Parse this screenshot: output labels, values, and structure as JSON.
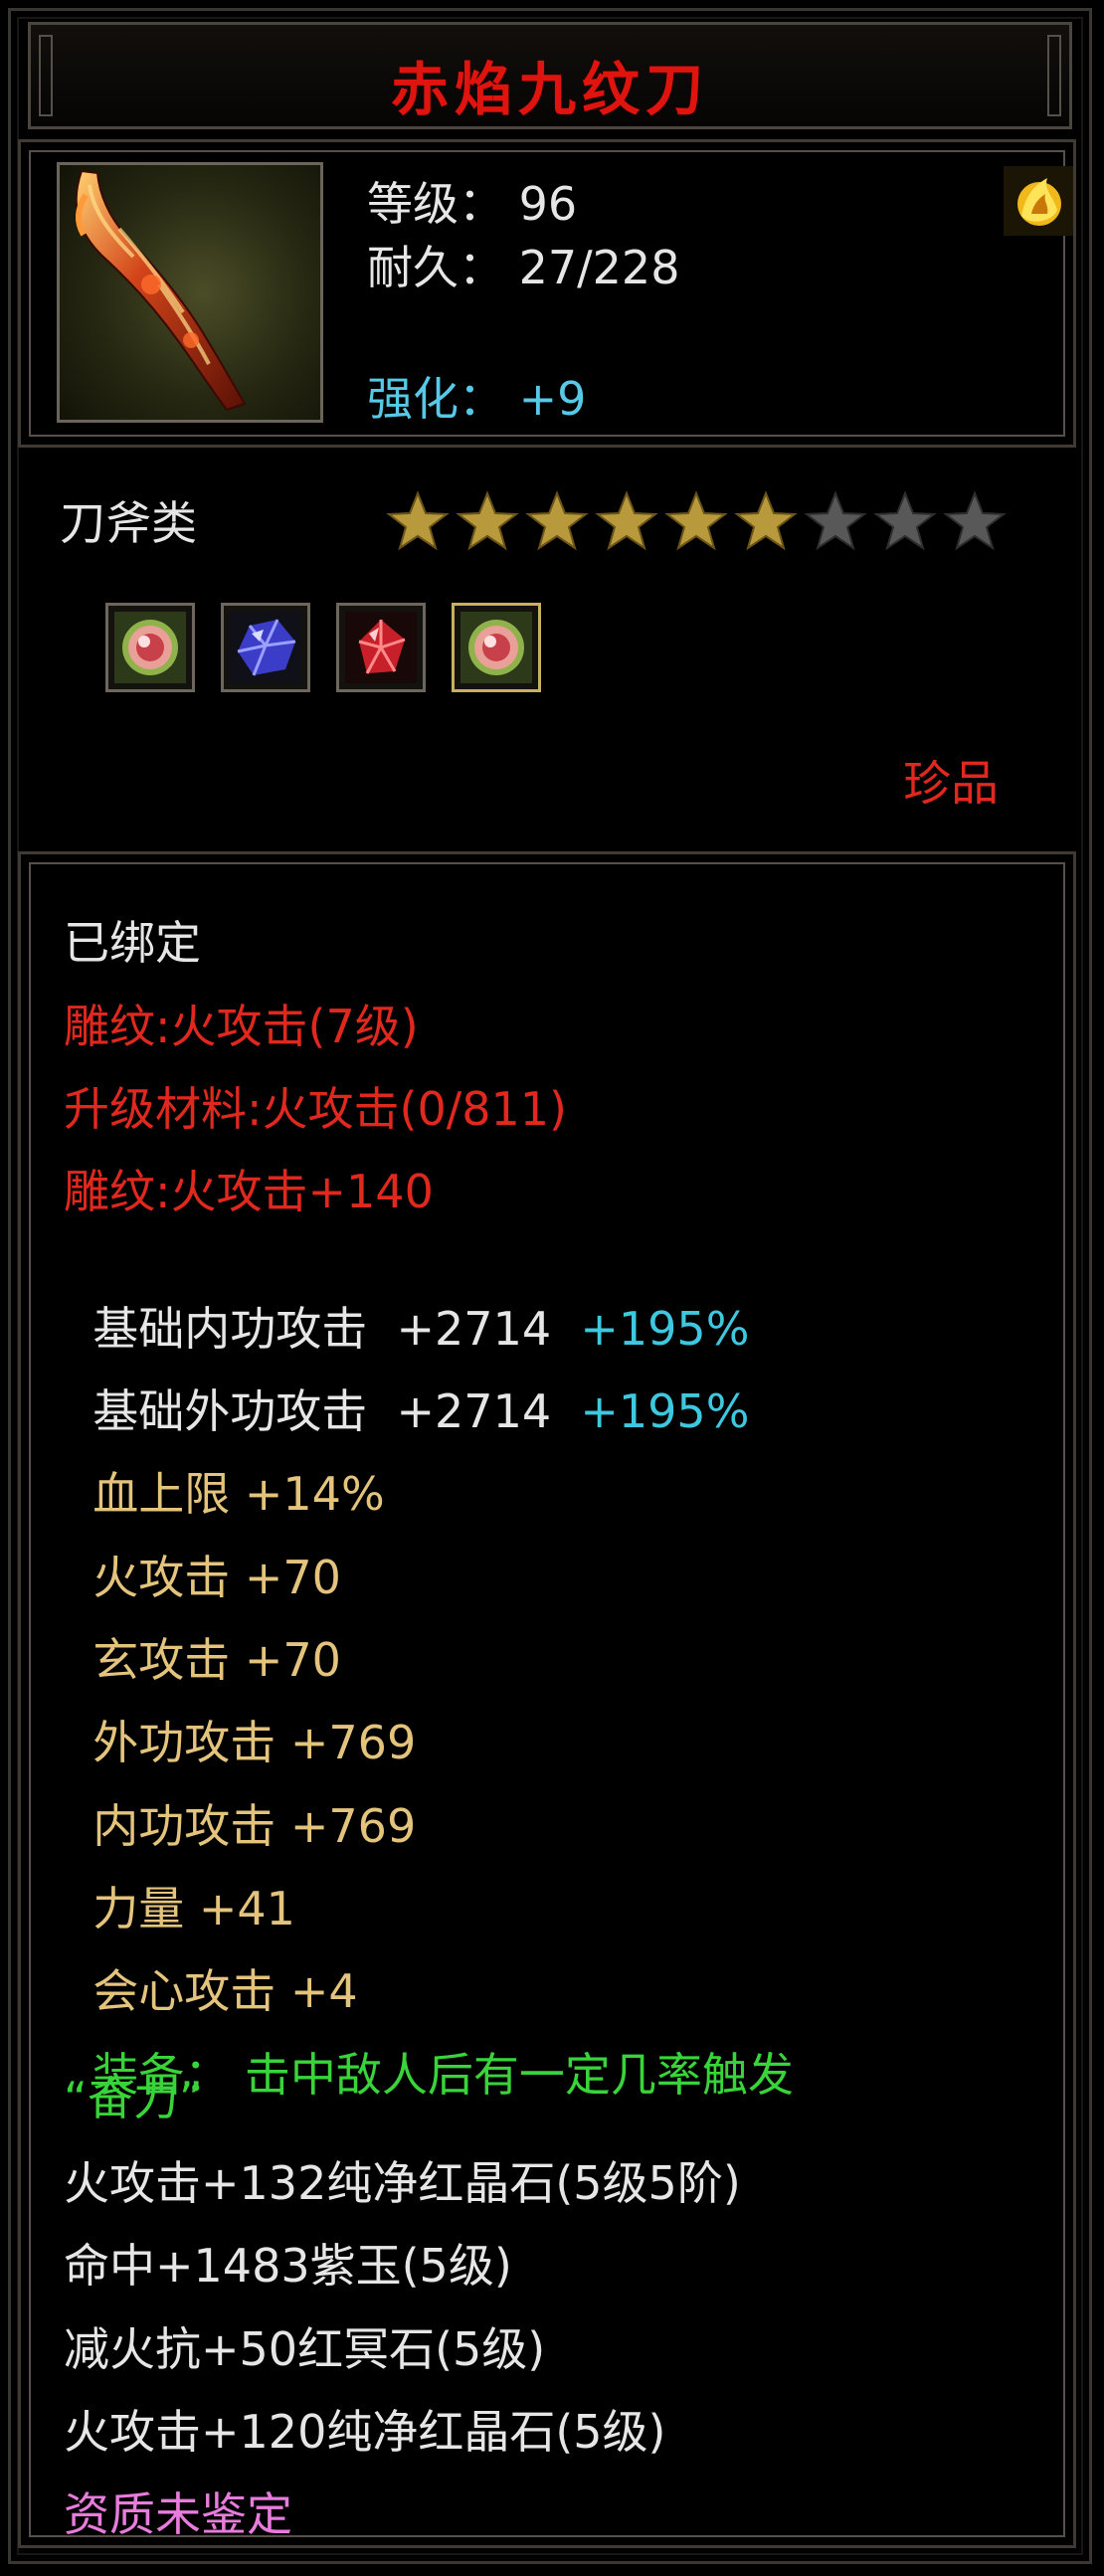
{
  "item": {
    "name": "赤焰九纹刀",
    "level_label": "等级：",
    "level_value": "96",
    "durability_label": "耐久：",
    "durability_value": "27/228",
    "enhance_label": "强化：",
    "enhance_value": "+9",
    "weapon_class": "刀斧类",
    "stars_total": 9,
    "stars_filled": 6,
    "rarity": "珍品",
    "icon": "blade-icon",
    "colors": {
      "title": "#e0140e",
      "rarity": "#e0281e",
      "enhance": "#57c9e6",
      "star_filled": "#b8993c",
      "star_empty": "#585858"
    }
  },
  "gems": [
    {
      "icon": "round-red-gem-icon",
      "selected": false
    },
    {
      "icon": "blue-crystal-icon",
      "selected": false
    },
    {
      "icon": "red-crystal-icon",
      "selected": false
    },
    {
      "icon": "round-red-gem-icon",
      "selected": true
    }
  ],
  "details": {
    "bound": "已绑定",
    "engrave_1": "雕纹:火攻击(7级)",
    "upgrade_material": "升级材料:火攻击(0/811)",
    "engrave_2": "雕纹:火攻击+140",
    "base_inner_label": "基础内功攻击",
    "base_inner_value": "+2714",
    "base_inner_pct": "+195%",
    "base_outer_label": "基础外功攻击",
    "base_outer_value": "+2714",
    "base_outer_pct": "+195%",
    "hp_label": "血上限",
    "hp_value": "+14%",
    "fire_label": "火攻击",
    "fire_value": "+70",
    "mystic_label": "玄攻击",
    "mystic_value": "+70",
    "outer_label": "外功攻击",
    "outer_value": "+769",
    "inner_label": "内功攻击",
    "inner_value": "+769",
    "str_label": "力量",
    "str_value": "+41",
    "crit_label": "会心攻击",
    "crit_value": "+4",
    "equip_label": "装备：",
    "equip_text": "击中敌人后有一定几率触发",
    "equip_text_2": "“奋力”",
    "socket_1": "火攻击+132纯净红晶石(5级5阶)",
    "socket_2": "命中+1483紫玉(5级)",
    "socket_3": "减火抗+50红冥石(5级)",
    "socket_4": "火攻击+120纯净红晶石(5级)",
    "quality": "资质未鉴定"
  }
}
